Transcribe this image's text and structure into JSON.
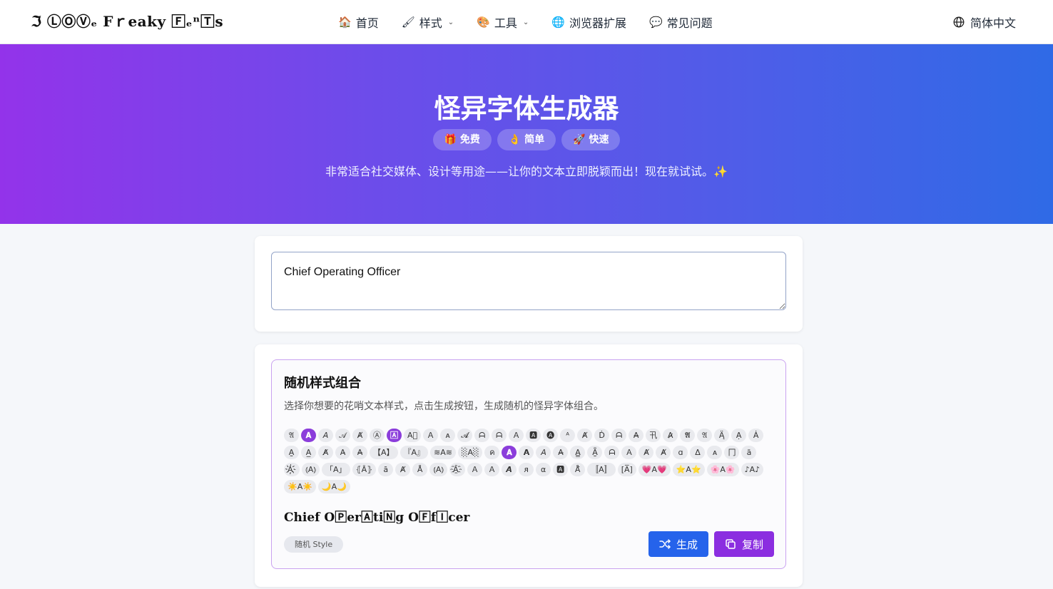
{
  "nav": {
    "logo": "ℑ ⓁⓄⓋₑ Fｒeaky 🄵ₑⁿ🅃s",
    "items": [
      {
        "icon": "🏠",
        "label": "首页",
        "dropdown": false
      },
      {
        "icon": "🖌",
        "label": "样式",
        "dropdown": true
      },
      {
        "icon": "🎨",
        "label": "工具",
        "dropdown": true
      },
      {
        "icon": "🌐",
        "label": "浏览器扩展",
        "dropdown": false
      },
      {
        "icon": "💬",
        "label": "常见问题",
        "dropdown": false
      }
    ],
    "language": "简体中文"
  },
  "hero": {
    "title": "怪异字体生成器",
    "badges": [
      "🎁 免费",
      "👌 简单",
      "🚀 快速"
    ],
    "subtitle": "非常适合社交媒体、设计等用途——让你的文本立即脱颖而出！现在就试试。✨"
  },
  "input": {
    "value": "Chief Operating Officer"
  },
  "random": {
    "title": "随机样式组合",
    "description": "选择你想要的花哨文本样式，点击生成按钮，生成随机的怪异字体组合。",
    "chips": [
      {
        "text": "𝔄",
        "active": false
      },
      {
        "text": "𝐀",
        "active": true
      },
      {
        "text": "𝘈",
        "active": false
      },
      {
        "text": "𝒜",
        "active": false
      },
      {
        "text": "Ⱥ",
        "active": false
      },
      {
        "text": "Ⓐ",
        "active": false
      },
      {
        "text": "🄰",
        "active": true
      },
      {
        "text": "A⃞",
        "active": false
      },
      {
        "text": "Ａ",
        "active": false
      },
      {
        "text": "ᴀ",
        "active": false
      },
      {
        "text": "𝓐",
        "active": false
      },
      {
        "text": "ᗩ",
        "active": false
      },
      {
        "text": "ᗩ",
        "active": false
      },
      {
        "text": "Ａ",
        "active": false
      },
      {
        "text": "🅰",
        "active": false
      },
      {
        "text": "🅐",
        "active": false
      },
      {
        "text": "ᴬ",
        "active": false
      },
      {
        "text": "Ⱥ",
        "active": false
      },
      {
        "text": "Ḋ",
        "active": false
      },
      {
        "text": "ᗩ",
        "active": false
      },
      {
        "text": "A̶",
        "active": false
      },
      {
        "text": "卂",
        "active": false
      },
      {
        "text": "A̷",
        "active": false
      },
      {
        "text": "𝕬",
        "active": false
      },
      {
        "text": "𝔄",
        "active": false
      },
      {
        "text": "Ą̈",
        "active": false
      },
      {
        "text": "Ạ",
        "active": false
      },
      {
        "text": "Ȧ",
        "active": false
      },
      {
        "text": "A̰",
        "active": false
      },
      {
        "text": "A̲",
        "active": false
      },
      {
        "text": "A̸",
        "active": false
      },
      {
        "text": "A̵",
        "active": false
      },
      {
        "text": "A̶",
        "active": false
      },
      {
        "text": "【A】",
        "active": false
      },
      {
        "text": "『A』",
        "active": false
      },
      {
        "text": "≋A≋",
        "active": false
      },
      {
        "text": "░A░",
        "active": false
      },
      {
        "text": "ค",
        "active": false
      },
      {
        "text": "𝐀",
        "active": true
      },
      {
        "text": "𝗔",
        "active": false
      },
      {
        "text": "𝘈",
        "active": false
      },
      {
        "text": "A̶",
        "active": false
      },
      {
        "text": "A̳",
        "active": false
      },
      {
        "text": "A̺͆",
        "active": false
      },
      {
        "text": "ᗩ",
        "active": false
      },
      {
        "text": "Ａ",
        "active": false
      },
      {
        "text": "Ⱥ",
        "active": false
      },
      {
        "text": "Ⱥ",
        "active": false
      },
      {
        "text": "ɑ",
        "active": false
      },
      {
        "text": "Δ",
        "active": false
      },
      {
        "text": "ᴀ",
        "active": false
      },
      {
        "text": "冂",
        "active": false
      },
      {
        "text": "ă",
        "active": false
      },
      {
        "text": "A҉",
        "active": false
      },
      {
        "text": "⦅A⦆",
        "active": false
      },
      {
        "text": "「A」",
        "active": false
      },
      {
        "text": "⦃Ȃ⦄",
        "active": false
      },
      {
        "text": "ā",
        "active": false
      },
      {
        "text": "Ⱥ",
        "active": false
      },
      {
        "text": "Å",
        "active": false
      },
      {
        "text": "⦅A⦆",
        "active": false
      },
      {
        "text": "A҈",
        "active": false
      },
      {
        "text": "Ａ",
        "active": false
      },
      {
        "text": "Ａ",
        "active": false
      },
      {
        "text": "𝘼",
        "active": false
      },
      {
        "text": "ᴙ",
        "active": false
      },
      {
        "text": "α",
        "active": false
      },
      {
        "text": "🅰",
        "active": false
      },
      {
        "text": "Å̈",
        "active": false
      },
      {
        "text": "〚A〛",
        "active": false
      },
      {
        "text": "[A̅]",
        "active": false
      },
      {
        "text": "💗A💗",
        "active": false
      },
      {
        "text": "⭐A⭐",
        "active": false
      },
      {
        "text": "🌸A🌸",
        "active": false
      },
      {
        "text": "♪A♪",
        "active": false
      },
      {
        "text": "☀️A☀️",
        "active": false
      },
      {
        "text": "🌙A🌙",
        "active": false
      }
    ],
    "result": "Chief O🄿er🄰ti🄽g O🄵f🄸cer",
    "style_tag": "随机 Style",
    "generate_label": "生成",
    "copy_label": "复制"
  }
}
